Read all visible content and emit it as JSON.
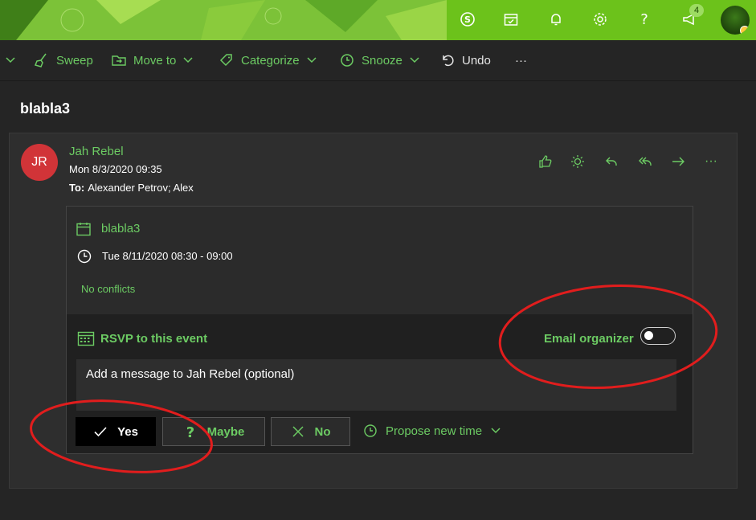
{
  "header": {
    "icons": [
      "skype-icon",
      "calendar-check-icon",
      "bell-icon",
      "gear-icon",
      "help-icon",
      "megaphone-icon"
    ],
    "notification_count": "4",
    "accent": "#6cc21b"
  },
  "toolbar": {
    "sweep": "Sweep",
    "move_to": "Move to",
    "categorize": "Categorize",
    "snooze": "Snooze",
    "undo": "Undo",
    "more": "···"
  },
  "message": {
    "subject": "blabla3",
    "initials": "JR",
    "sender": "Jah Rebel",
    "date": "Mon 8/3/2020 09:35",
    "to_label": "To:",
    "to_value": "Alexander Petrov; Alex",
    "more": "···"
  },
  "invite": {
    "title": "blabla3",
    "time": "Tue 8/11/2020 08:30 - 09:00",
    "conflicts": "No conflicts",
    "rsvp_title": "RSVP to this event",
    "email_organizer": "Email organizer",
    "email_organizer_on": false,
    "message_text": "Add a message to Jah Rebel (optional)",
    "yes": "Yes",
    "maybe": "Maybe",
    "no": "No",
    "propose": "Propose new time"
  },
  "colors": {
    "green": "#6ccb63",
    "annotation": "#e11d1d",
    "avatar": "#d13438"
  }
}
